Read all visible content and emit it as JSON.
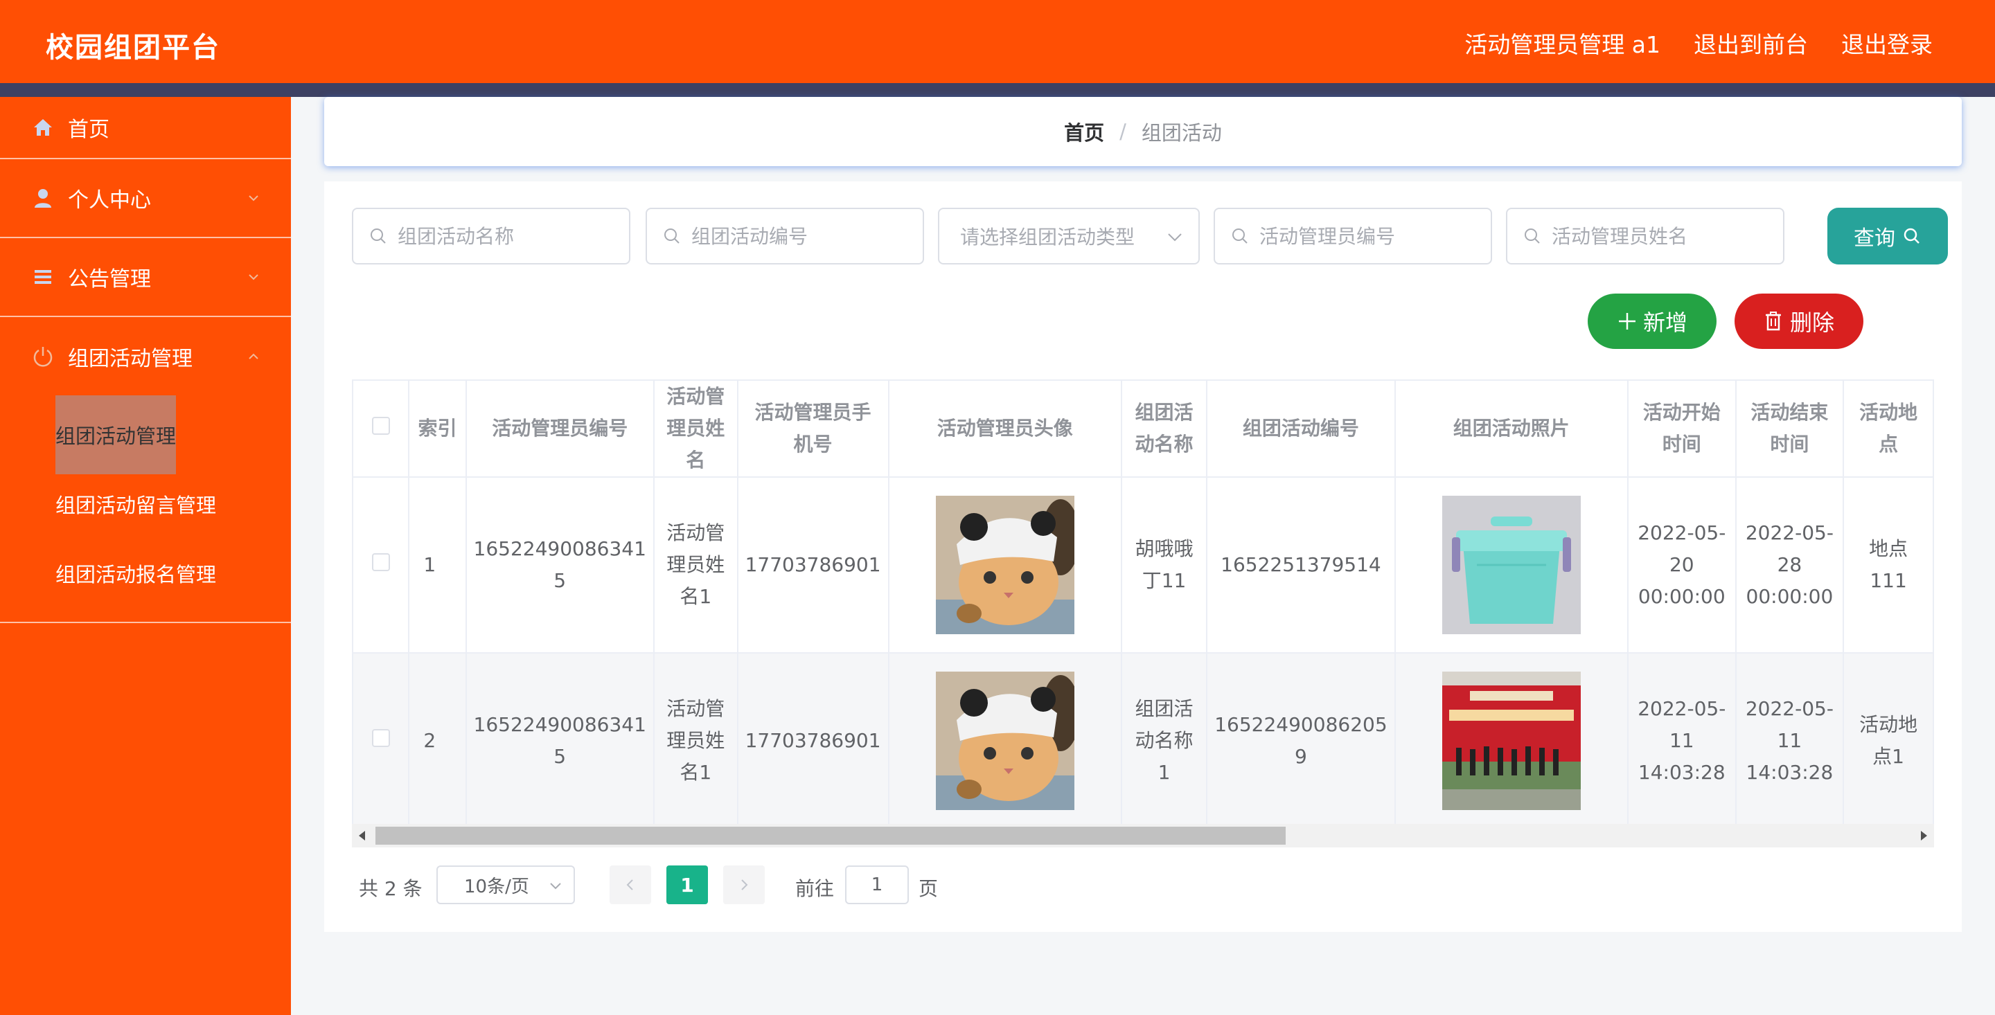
{
  "header": {
    "title": "校园组团平台",
    "role_user": "活动管理员管理 a1",
    "back_to_front": "退出到前台",
    "logout": "退出登录"
  },
  "sidebar": {
    "items": [
      {
        "label": "首页",
        "icon": "home-icon"
      },
      {
        "label": "个人中心",
        "icon": "user-icon"
      },
      {
        "label": "公告管理",
        "icon": "list-icon"
      },
      {
        "label": "组团活动管理",
        "icon": "power-icon"
      }
    ],
    "subitems": [
      {
        "label": "组团活动管理"
      },
      {
        "label": "组团活动留言管理"
      },
      {
        "label": "组团活动报名管理"
      }
    ]
  },
  "breadcrumb": {
    "home": "首页",
    "separator": "/",
    "current": "组团活动"
  },
  "search": {
    "name_placeholder": "组团活动名称",
    "code_placeholder": "组团活动编号",
    "type_placeholder": "请选择组团活动类型",
    "admin_code_placeholder": "活动管理员编号",
    "admin_name_placeholder": "活动管理员姓名",
    "query_label": "查询"
  },
  "actions": {
    "add_label": "新增",
    "delete_label": "删除"
  },
  "table": {
    "headers": {
      "index": "索引",
      "admin_code": "活动管理员编号",
      "admin_name": "活动管理员姓名",
      "admin_phone": "活动管理员手机号",
      "admin_avatar": "活动管理员头像",
      "activity_name": "组团活动名称",
      "activity_code": "组团活动编号",
      "activity_photo": "组团活动照片",
      "start_time": "活动开始时间",
      "end_time": "活动结束时间",
      "location": "活动地点"
    },
    "rows": [
      {
        "index": "1",
        "admin_code": "16522490086341 5",
        "admin_name": "活动管理员姓名1",
        "admin_phone": "17703786901",
        "activity_name": "胡哦哦丁11",
        "activity_code": "1652251379514",
        "start_time": "2022-05-20 00:00:00",
        "end_time": "2022-05-28 00:00:00",
        "location": "地点111"
      },
      {
        "index": "2",
        "admin_code": "16522490086341 5",
        "admin_name": "活动管理员姓名1",
        "admin_phone": "17703786901",
        "activity_name": "组团活动名称1",
        "activity_code": "16522490086205 9",
        "start_time": "2022-05-11 14:03:28",
        "end_time": "2022-05-11 14:03:28",
        "location": "活动地点1"
      }
    ]
  },
  "pagination": {
    "total": "共 2 条",
    "page_size": "10条/页",
    "current_page": "1",
    "goto_label": "前往",
    "goto_value": "1",
    "page_suffix": "页"
  },
  "colors": {
    "brand": "#ff4f04",
    "strip": "#3d4163",
    "query": "#27a39a",
    "add": "#24a344",
    "delete": "#d9201f",
    "page_active": "#18b38a"
  }
}
